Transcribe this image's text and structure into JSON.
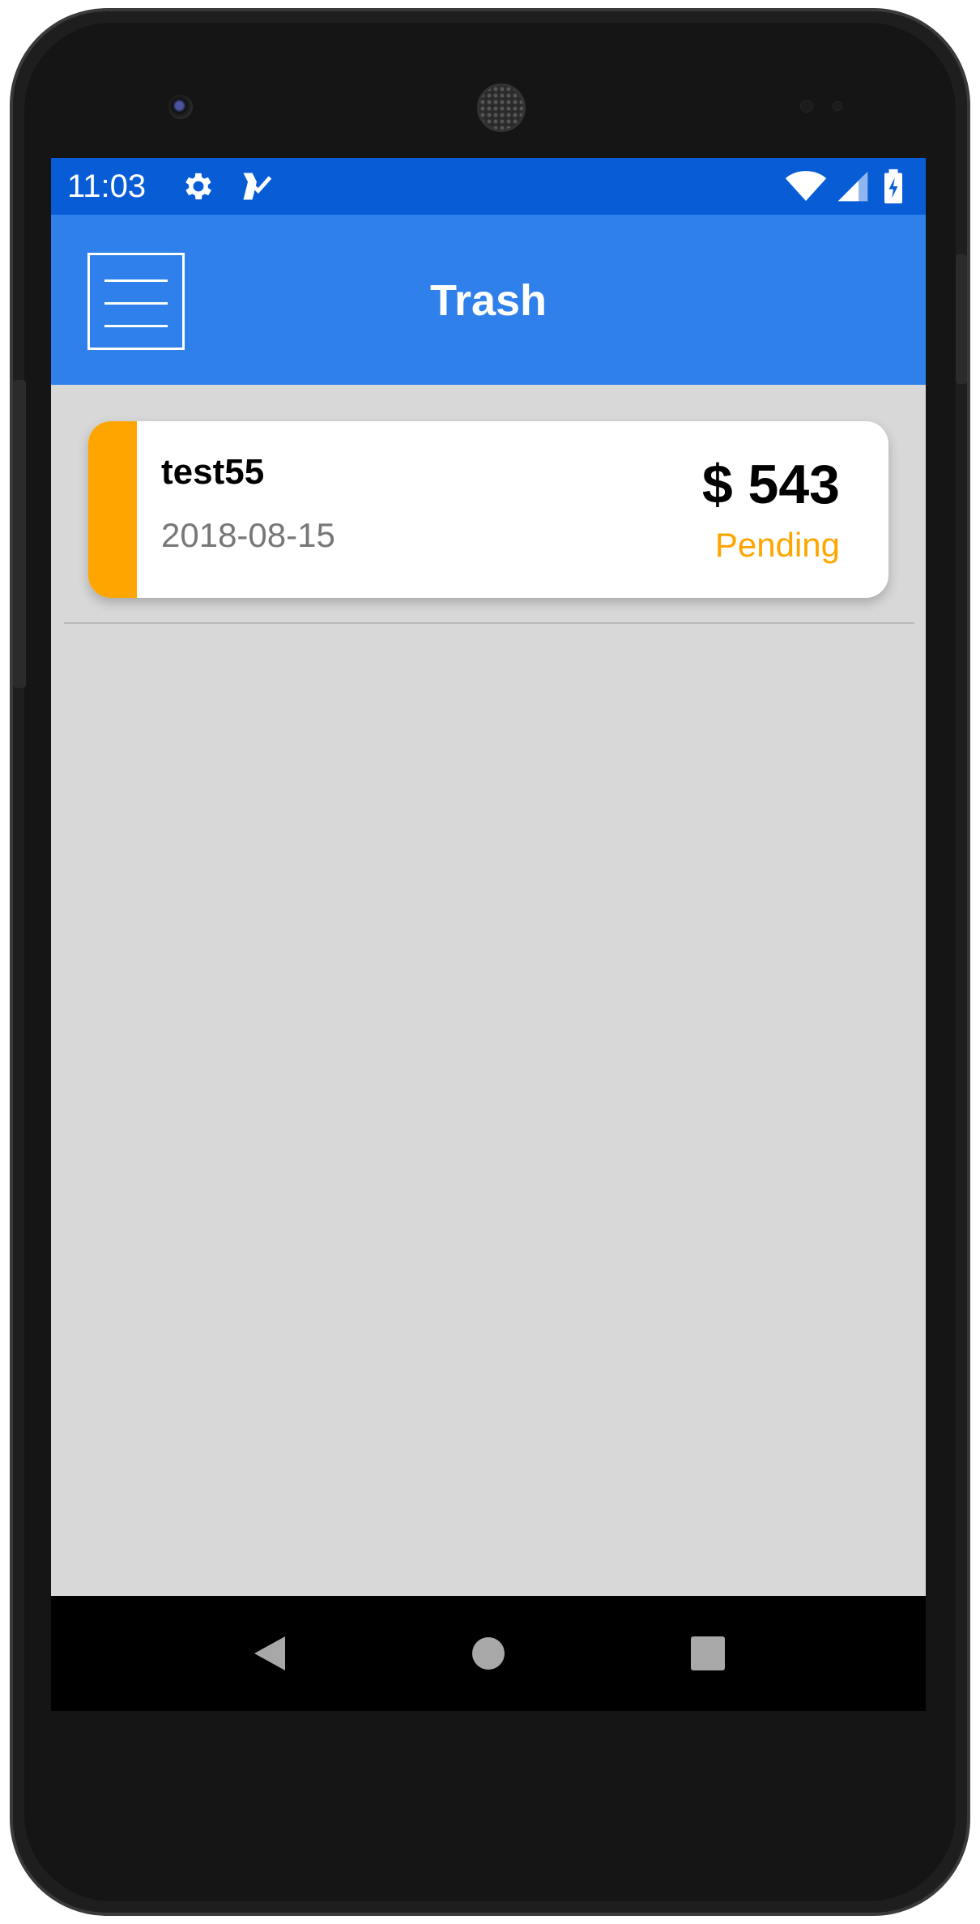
{
  "status_bar": {
    "time": "11:03",
    "left_icons": [
      "gear-icon",
      "task-check-icon"
    ],
    "right_icons": [
      "wifi-icon",
      "cell-signal-icon",
      "battery-charging-icon"
    ],
    "background": "#085dd6"
  },
  "app_bar": {
    "title": "Trash",
    "menu_icon": "hamburger-menu-icon",
    "background": "#2f80ea"
  },
  "list": {
    "items": [
      {
        "name": "test55",
        "date": "2018-08-15",
        "amount": "$ 543",
        "status": "Pending",
        "status_color": "#ffa500"
      }
    ]
  },
  "nav_bar": {
    "icons": [
      "back-icon",
      "home-icon",
      "recents-icon"
    ]
  },
  "colors": {
    "content_background": "#d8d8d8",
    "pending_accent": "#ffa500"
  }
}
